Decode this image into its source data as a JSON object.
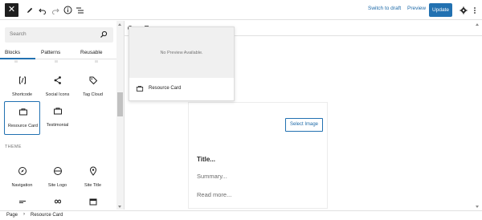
{
  "toolbar": {
    "close_glyph": "✕",
    "switch_to_draft": "Switch to draft",
    "preview": "Preview",
    "update": "Update",
    "accent_color": "#2271b1"
  },
  "sidebar": {
    "search_placeholder": "Search",
    "tabs": [
      {
        "label": "Blocks",
        "active": true
      },
      {
        "label": "Patterns",
        "active": false
      },
      {
        "label": "Reusable",
        "active": false
      }
    ],
    "blocks": [
      {
        "label": "Shortcode",
        "icon": "shortcode-icon"
      },
      {
        "label": "Social Icons",
        "icon": "share-icon"
      },
      {
        "label": "Tag Cloud",
        "icon": "tag-icon"
      },
      {
        "label": "Resource Card",
        "icon": "card-icon",
        "selected": true
      },
      {
        "label": "Testimonial",
        "icon": "card-icon"
      }
    ],
    "theme_section_label": "THEME",
    "theme_blocks": [
      {
        "label": "Navigation",
        "icon": "compass-icon"
      },
      {
        "label": "Site Logo",
        "icon": "site-logo-icon"
      },
      {
        "label": "Site Title",
        "icon": "map-pin-icon"
      }
    ]
  },
  "preview": {
    "no_preview_text": "No Preview Available.",
    "block_name": "Resource Card"
  },
  "card": {
    "select_image": "Select Image",
    "title": "Title...",
    "summary": "Summary...",
    "read_more": "Read more..."
  },
  "breadcrumb": {
    "items": [
      "Page",
      "Resource Card"
    ],
    "separator": "›"
  }
}
